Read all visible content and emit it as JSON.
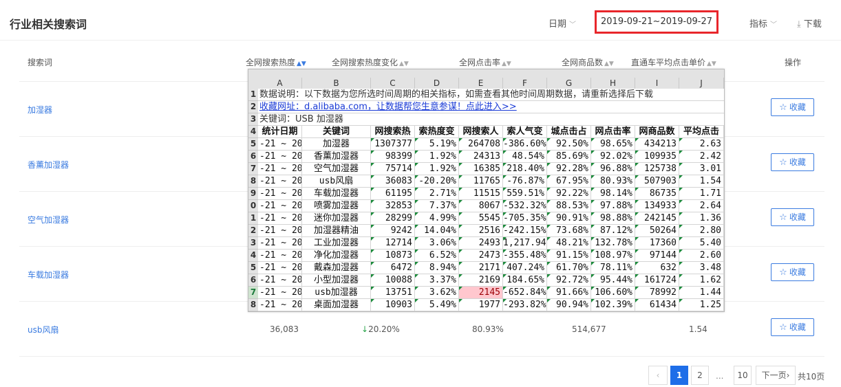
{
  "page": {
    "title": "行业相关搜索词",
    "date_label": "日期",
    "date_range": "2019-09-21~2019-09-27",
    "metric_label": "指标",
    "download_label": "下载"
  },
  "table": {
    "headers": {
      "keyword": "搜索词",
      "heat": "全网搜索热度",
      "heat_change": "全网搜索热度变化",
      "ctr": "全网点击率",
      "goods": "全网商品数",
      "cpc": "直通车平均点击单价",
      "action": "操作"
    },
    "rows": [
      {
        "keyword": "加湿器"
      },
      {
        "keyword": "香薰加湿器"
      },
      {
        "keyword": "空气加湿器"
      },
      {
        "keyword": "车载加湿器"
      },
      {
        "keyword": "usb风扇",
        "heat": "36,083",
        "heat_change": "20.20%",
        "ctr": "80.93%",
        "goods": "514,677",
        "cpc": "1.54"
      }
    ],
    "collect_label": "收藏"
  },
  "pagination": {
    "pages": [
      "1",
      "2",
      "...",
      "10"
    ],
    "next": "下一页",
    "total": "共10页"
  },
  "excel": {
    "columns": [
      "A",
      "B",
      "C",
      "D",
      "E",
      "F",
      "G",
      "H",
      "I",
      "J"
    ],
    "row_numbers": [
      "1",
      "2",
      "3",
      "4",
      "5",
      "6",
      "7",
      "8",
      "9",
      "0",
      "1",
      "2",
      "3",
      "4",
      "5",
      "6",
      "7",
      "8"
    ],
    "note": "数据说明：以下数据为您所选时间周期的相关指标，如需查看其他时间周期数据，请重新选择后下载",
    "link": "收藏网址：d.alibaba.com，让数据帮您生意参谋！点此进入>>",
    "keyword_line": "关键词：USB 加湿器",
    "headers": [
      "统计日期",
      "关键词",
      "网搜索热",
      "索热度变",
      "网搜索人",
      "索人气变",
      "城点击占",
      "网点击率",
      "网商品数",
      "平均点击"
    ],
    "rows": [
      [
        "-21 ~ 20",
        "加湿器",
        "1307377",
        "5.19%",
        "264708",
        "-386.60%",
        "92.50%",
        "98.65%",
        "434213",
        "2.63"
      ],
      [
        "-21 ~ 20",
        "香薰加湿器",
        "98399",
        "1.92%",
        "24313",
        "48.54%",
        "85.69%",
        "92.02%",
        "109935",
        "2.42"
      ],
      [
        "-21 ~ 20",
        "空气加湿器",
        "75714",
        "1.92%",
        "16385",
        "218.40%",
        "92.28%",
        "96.88%",
        "125738",
        "3.01"
      ],
      [
        "-21 ~ 20",
        "usb风扇",
        "36083",
        "-20.20%",
        "11765",
        "-76.87%",
        "67.95%",
        "80.93%",
        "507903",
        "1.54"
      ],
      [
        "-21 ~ 20",
        "车载加湿器",
        "61195",
        "2.71%",
        "11515",
        "559.51%",
        "92.22%",
        "98.14%",
        "86735",
        "1.71"
      ],
      [
        "-21 ~ 20",
        "喷雾加湿器",
        "32853",
        "7.37%",
        "8067",
        "-532.32%",
        "88.53%",
        "97.88%",
        "134933",
        "2.64"
      ],
      [
        "-21 ~ 20",
        "迷你加湿器",
        "28299",
        "4.99%",
        "5545",
        "-705.35%",
        "90.91%",
        "98.88%",
        "242145",
        "1.36"
      ],
      [
        "-21 ~ 20",
        "加湿器精油",
        "9242",
        "14.04%",
        "2516",
        "-242.15%",
        "73.68%",
        "87.12%",
        "50264",
        "2.80"
      ],
      [
        "-21 ~ 20",
        "工业加湿器",
        "12714",
        "3.06%",
        "2493",
        "1,217.94",
        "48.21%",
        "132.78%",
        "17360",
        "5.40"
      ],
      [
        "-21 ~ 20",
        "净化加湿器",
        "10873",
        "6.52%",
        "2473",
        "-355.48%",
        "91.15%",
        "108.97%",
        "97144",
        "2.60"
      ],
      [
        "-21 ~ 20",
        "戴森加湿器",
        "6472",
        "8.94%",
        "2171",
        "407.24%",
        "61.70%",
        "78.11%",
        "632",
        "3.48"
      ],
      [
        "-21 ~ 20",
        "小型加湿器",
        "10088",
        "3.37%",
        "2169",
        "184.65%",
        "92.72%",
        "95.44%",
        "161724",
        "1.62"
      ],
      [
        "-21 ~ 20",
        "usb加湿器",
        "13751",
        "3.62%",
        "2145",
        "-652.84%",
        "91.66%",
        "106.60%",
        "78992",
        "1.44"
      ],
      [
        "-21 ~ 20",
        "桌面加湿器",
        "10903",
        "5.49%",
        "1977",
        "-293.82%",
        "90.94%",
        "102.39%",
        "61434",
        "1.25"
      ]
    ]
  }
}
